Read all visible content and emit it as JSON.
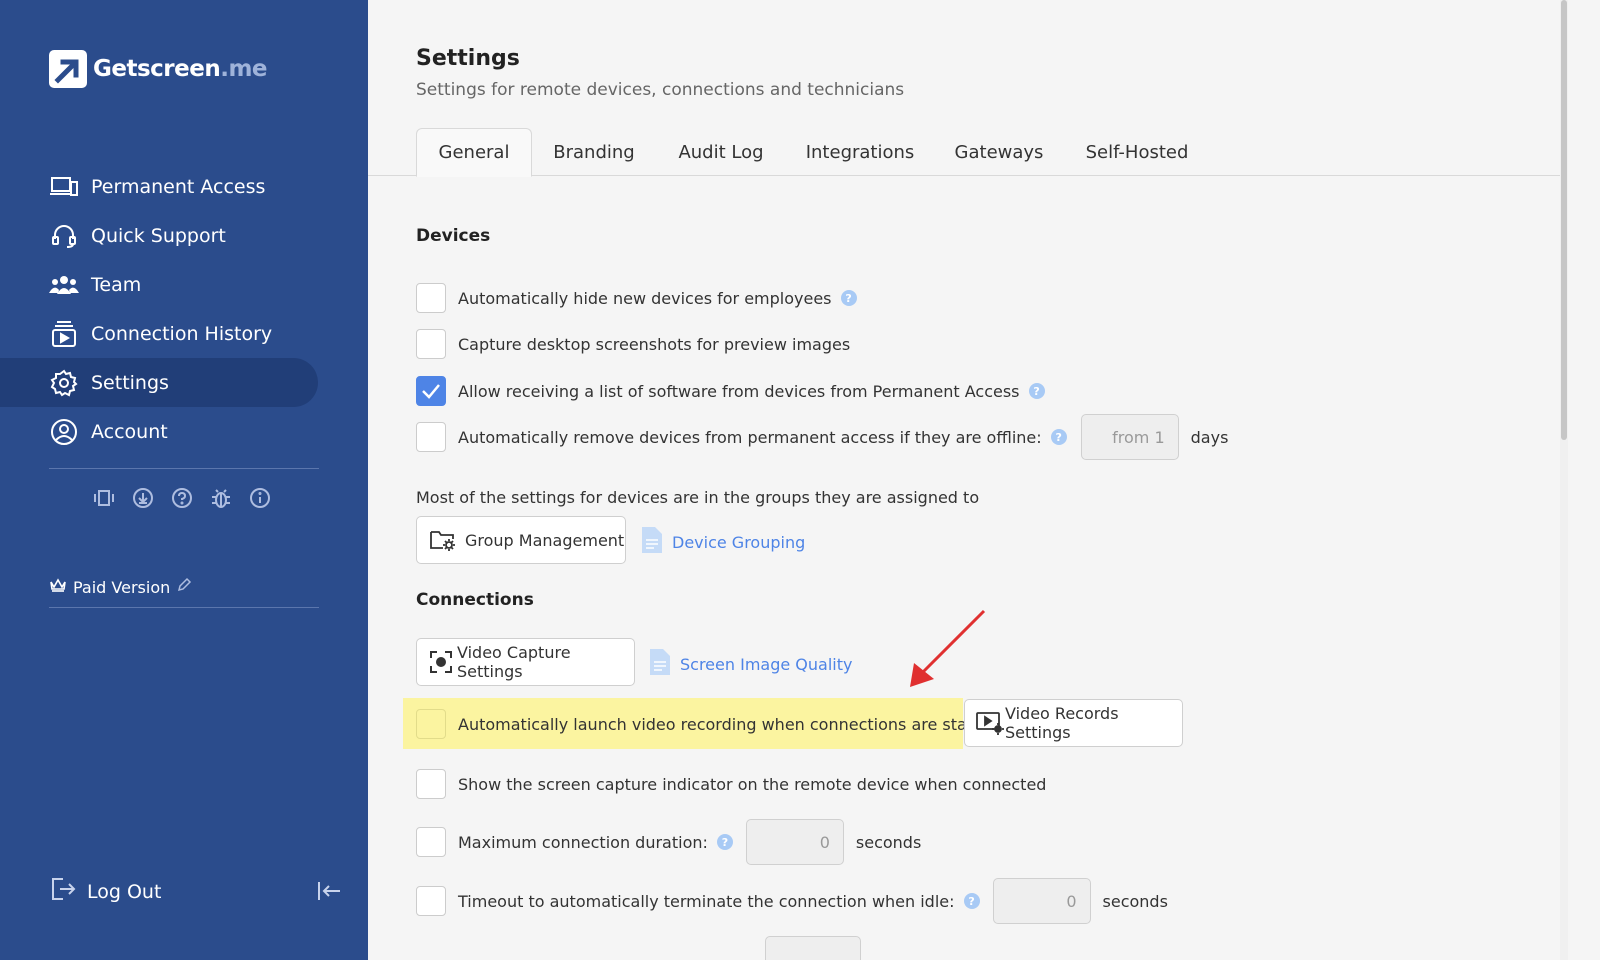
{
  "brand": {
    "name_main": "Getscreen",
    "name_suffix": ".me"
  },
  "sidebar": {
    "items": [
      {
        "label": "Permanent Access",
        "icon": "devices-icon"
      },
      {
        "label": "Quick Support",
        "icon": "headset-icon"
      },
      {
        "label": "Team",
        "icon": "team-icon"
      },
      {
        "label": "Connection History",
        "icon": "history-icon"
      },
      {
        "label": "Settings",
        "icon": "gear-icon",
        "active": true
      },
      {
        "label": "Account",
        "icon": "account-icon"
      }
    ],
    "utility_icons": [
      "slides-icon",
      "download-icon",
      "help-icon",
      "bug-icon",
      "info-icon"
    ],
    "plan_label": "Paid Version",
    "logout_label": "Log Out"
  },
  "header": {
    "title": "Settings",
    "subtitle": "Settings for remote devices, connections and technicians"
  },
  "tabs": [
    "General",
    "Branding",
    "Audit Log",
    "Integrations",
    "Gateways",
    "Self-Hosted"
  ],
  "devices": {
    "heading": "Devices",
    "hide_new": {
      "label": "Automatically hide new devices for employees",
      "checked": false
    },
    "screenshots": {
      "label": "Capture desktop screenshots for preview images",
      "checked": false
    },
    "software_list": {
      "label": "Allow receiving a list of software from devices from Permanent Access",
      "checked": true
    },
    "auto_remove": {
      "label": "Automatically remove devices from permanent access if they are offline:",
      "checked": false,
      "placeholder": "from 1",
      "unit": "days"
    },
    "groups_note": "Most of the settings for devices are in the groups they are assigned to",
    "group_mgmt_button": "Group Management",
    "device_grouping_link": "Device Grouping"
  },
  "connections": {
    "heading": "Connections",
    "video_capture_button": "Video Capture Settings",
    "screen_quality_link": "Screen Image Quality",
    "auto_record": {
      "label": "Automatically launch video recording when connections are started",
      "checked": false
    },
    "video_records_button": "Video Records Settings",
    "capture_indicator": {
      "label": "Show the screen capture indicator on the remote device when connected",
      "checked": false
    },
    "max_duration": {
      "label": "Maximum connection duration:",
      "checked": false,
      "placeholder": "0",
      "unit": "seconds"
    },
    "idle_timeout": {
      "label": "Timeout to automatically terminate the connection when idle:",
      "checked": false,
      "placeholder": "0",
      "unit": "seconds"
    }
  },
  "colors": {
    "sidebar": "#2b4c8c",
    "accent": "#4e84e6",
    "highlight": "#fbf4a0",
    "arrow": "#e03030"
  }
}
